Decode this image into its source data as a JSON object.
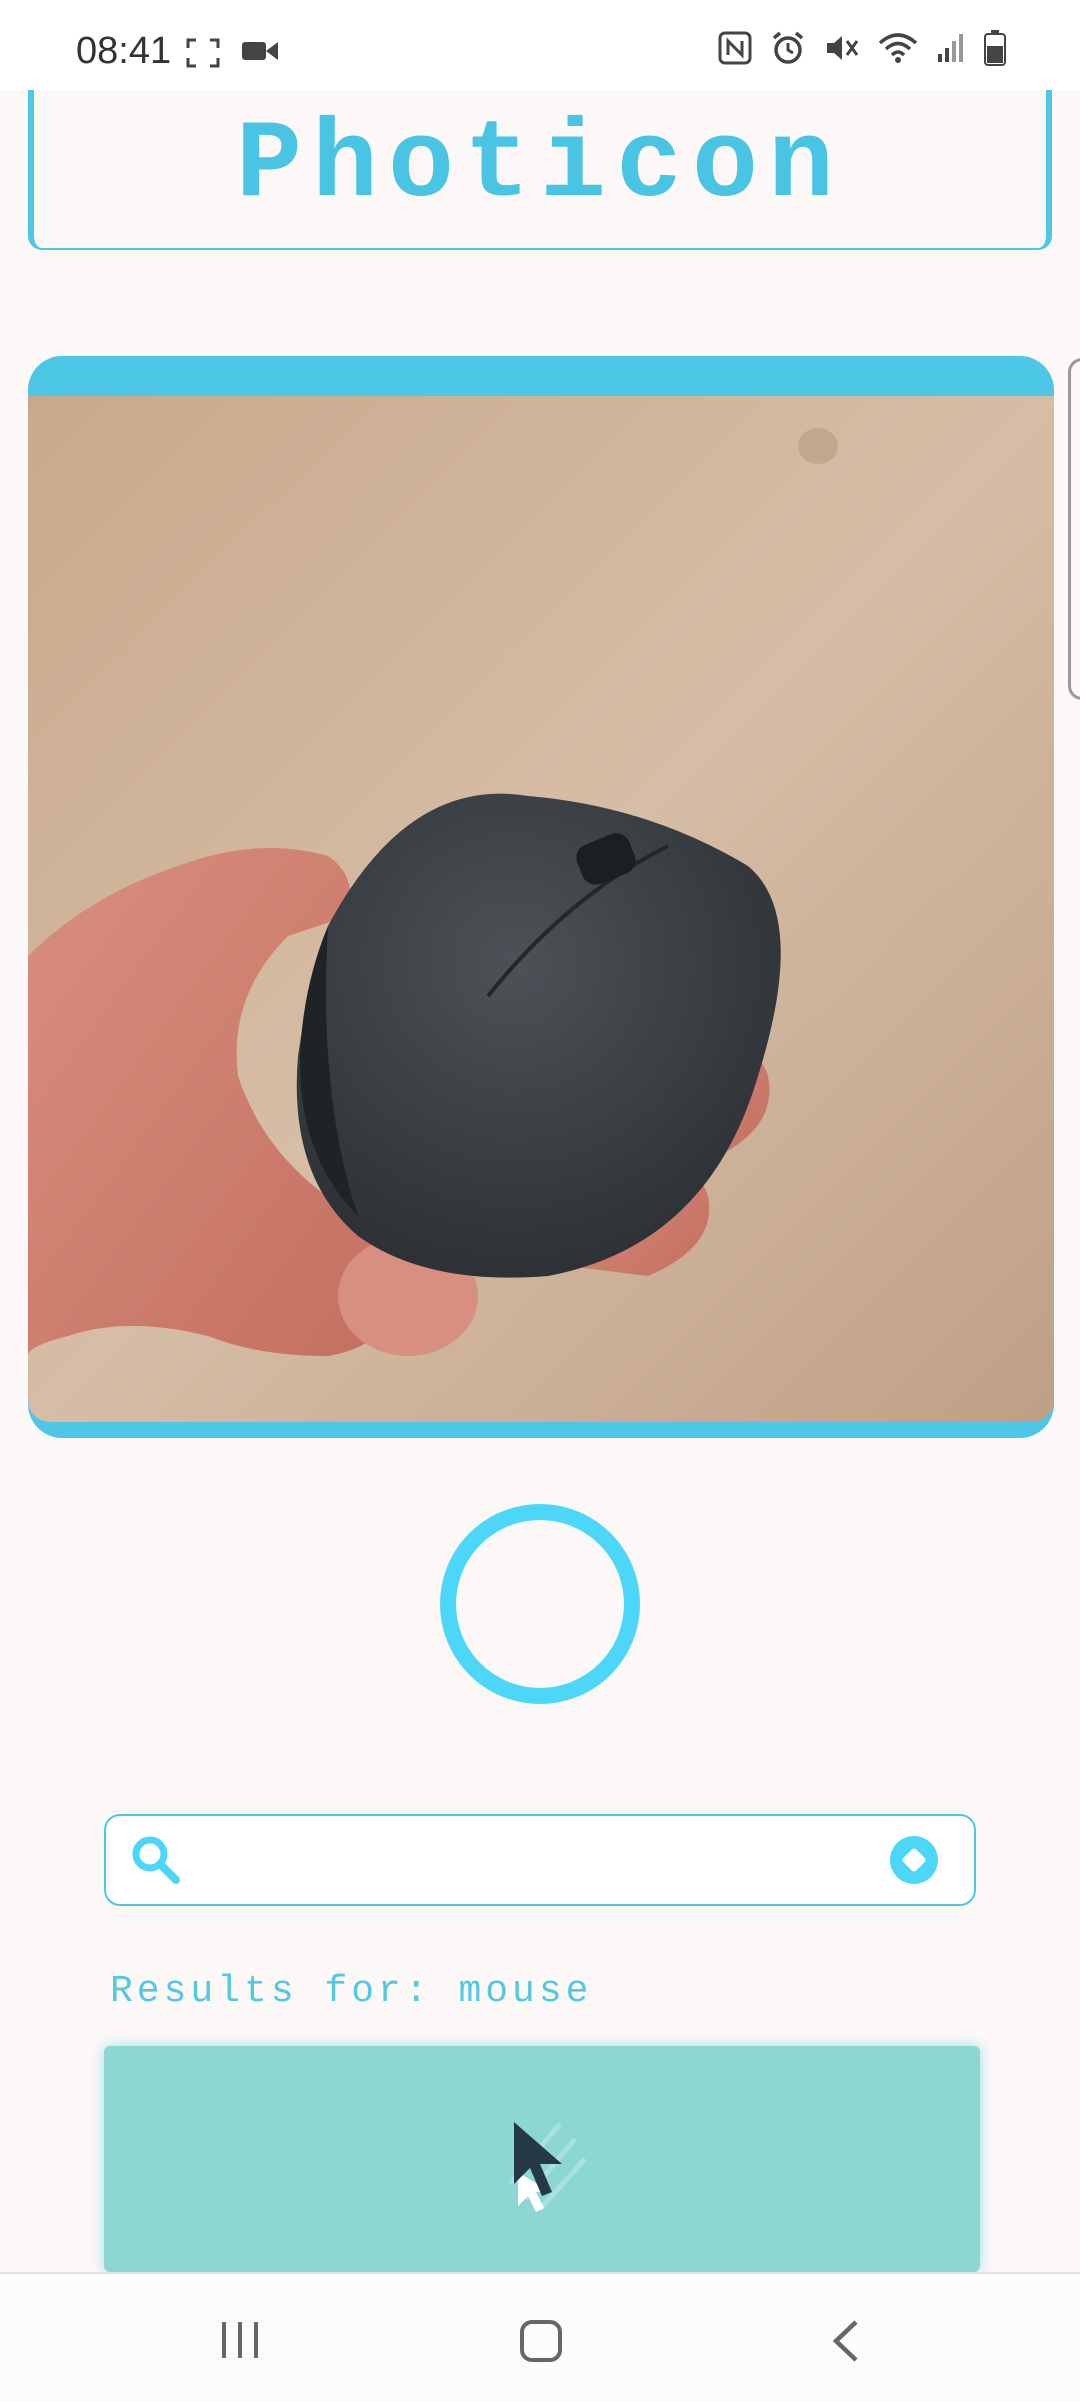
{
  "status_bar": {
    "time": "08:41",
    "left_icons": [
      "screenshot-frame-icon",
      "video-camera-icon"
    ],
    "right_icons": [
      "nfc-icon",
      "alarm-icon",
      "mute-icon",
      "wifi-icon",
      "signal-icon",
      "battery-icon"
    ]
  },
  "header": {
    "title": "Photicon"
  },
  "camera": {
    "capture_button": "capture-button",
    "colors": {
      "accent": "#4cc8e6",
      "capture": "#4cd6f8"
    }
  },
  "search": {
    "value": "",
    "placeholder": ""
  },
  "results": {
    "text": "Results for: mouse"
  },
  "nav": {
    "buttons": [
      "recent-apps",
      "home",
      "back"
    ]
  }
}
